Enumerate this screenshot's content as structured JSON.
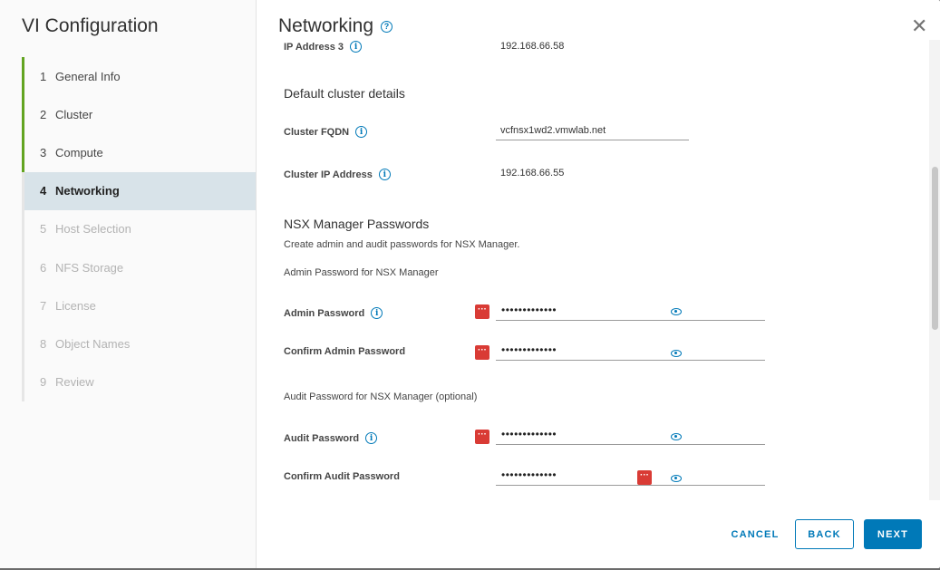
{
  "nav": {
    "title": "VI Configuration",
    "steps": [
      {
        "num": "1",
        "label": "General Info"
      },
      {
        "num": "2",
        "label": "Cluster"
      },
      {
        "num": "3",
        "label": "Compute"
      },
      {
        "num": "4",
        "label": "Networking"
      },
      {
        "num": "5",
        "label": "Host Selection"
      },
      {
        "num": "6",
        "label": "NFS Storage"
      },
      {
        "num": "7",
        "label": "License"
      },
      {
        "num": "8",
        "label": "Object Names"
      },
      {
        "num": "9",
        "label": "Review"
      }
    ]
  },
  "main": {
    "title": "Networking",
    "ip3_label": "IP Address 3",
    "ip3_value": "192.168.66.58",
    "cluster_section": "Default cluster details",
    "fqdn_label": "Cluster FQDN",
    "fqdn_value": "vcfnsx1wd2.vmwlab.net",
    "cluster_ip_label": "Cluster IP Address",
    "cluster_ip_value": "192.168.66.55",
    "nsx_section": "NSX Manager Passwords",
    "nsx_desc": "Create admin and audit passwords for NSX Manager.",
    "admin_sub": "Admin Password for NSX Manager",
    "admin_pw_label": "Admin Password",
    "admin_pw_value": "•••••••••••••",
    "confirm_admin_label": "Confirm Admin Password",
    "confirm_admin_value": "•••••••••••••",
    "audit_sub": "Audit Password for NSX Manager (optional)",
    "audit_pw_label": "Audit Password",
    "audit_pw_value": "•••••••••••••",
    "confirm_audit_label": "Confirm Audit Password",
    "confirm_audit_value": "•••••••••••••"
  },
  "footer": {
    "cancel": "CANCEL",
    "back": "BACK",
    "next": "NEXT"
  },
  "icons": {
    "help": "help-circle-icon",
    "info": "info-circle-icon",
    "close": "close-icon",
    "eye": "eye-icon",
    "password_manager": "password-manager-icon"
  },
  "colors": {
    "accent": "#0079b8",
    "done_step": "#62a420",
    "active_step_bg": "#d8e3e9",
    "pw_badge": "#d93b35"
  }
}
